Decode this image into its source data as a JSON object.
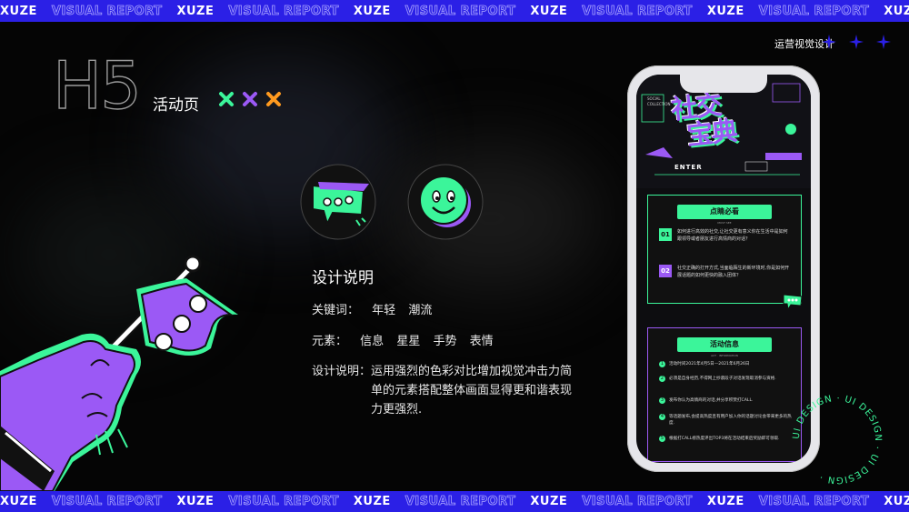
{
  "banner": {
    "segments": [
      {
        "text": "XUZE",
        "style": "solid"
      },
      {
        "text": "VISUAL REPORT",
        "style": "outline"
      },
      {
        "text": "XUZE",
        "style": "solid"
      },
      {
        "text": "VISUAL REPORT",
        "style": "outline"
      },
      {
        "text": "XUZE",
        "style": "solid"
      },
      {
        "text": "VISUAL REPORT",
        "style": "outline"
      },
      {
        "text": "XUZE",
        "style": "solid"
      },
      {
        "text": "VISUAL REPORT",
        "style": "outline"
      },
      {
        "text": "XUZE",
        "style": "solid"
      },
      {
        "text": "VISUAL REPORT",
        "style": "outline"
      },
      {
        "text": "XUZE",
        "style": "solid"
      },
      {
        "text": "VISUAL REPORT",
        "style": "outline"
      }
    ],
    "color": "#2b20e6"
  },
  "header": {
    "big_title": "H5",
    "subtitle": "活动页",
    "x_marks": [
      {
        "icon": "x-icon",
        "color": "#3bf59a"
      },
      {
        "icon": "x-icon",
        "color": "#9b59f5"
      },
      {
        "icon": "x-icon",
        "color": "#ff9a1f"
      }
    ],
    "top_right_label": "运营视觉设计",
    "stars": [
      {
        "icon": "sparkle-star-icon",
        "color": "#2b20e6"
      },
      {
        "icon": "sparkle-star-icon",
        "color": "#2b20e6"
      },
      {
        "icon": "sparkle-star-icon",
        "color": "#2b20e6"
      }
    ]
  },
  "icons": [
    {
      "name": "chat-bubble-icon",
      "bg": "#3bf59a"
    },
    {
      "name": "smiley-face-icon",
      "bg": "#3bf59a"
    }
  ],
  "description": {
    "title": "设计说明",
    "keywords_label": "关键词：",
    "keywords": [
      "年轻",
      "潮流"
    ],
    "elements_label": "元素：",
    "elements": [
      "信息",
      "星星",
      "手势",
      "表情"
    ],
    "explain_label": "设计说明：",
    "explain_text": "运用强烈的色彩对比增加视觉冲击力简单的元素搭配整体画面显得更和谐表现力更强烈."
  },
  "phone": {
    "hero_title_line1": "社交",
    "hero_title_line2": "宝典",
    "hero_small": "SOCIAL COLLECTION",
    "enter_label": "ENTER",
    "card1": {
      "heading": "点睛必看",
      "heading_sub": "MUST SEE",
      "questions": [
        {
          "num": "01",
          "text": "如何进行高效的社交,让社交更有意义你在生活中是如何跟领导或者朋友进行高情商的对话？"
        },
        {
          "num": "02",
          "text": "社交正确的打开方式,当面临陌生的新环境时,你是如何开展话题的如何更快的融入团体？"
        }
      ]
    },
    "card2": {
      "heading": "活动信息",
      "heading_sub": "ACT · INFORMATION",
      "items": [
        {
          "num": "1",
          "text": "活动时间2021年4月5日—2021年6月26日"
        },
        {
          "num": "2",
          "text": "必须是自身经历,不得网上抄袭段子对话发现取消参与资格."
        },
        {
          "num": "3",
          "text": "发布你认为高情商的对话,并分享积赞打CALL."
        },
        {
          "num": "4",
          "text": "等话题发布,会提高热度且有用户加入你的话题讨论会带来更多的热度."
        },
        {
          "num": "5",
          "text": "根据打CALL榜热度评出TOP3将在活动结束后奖励即可领取."
        }
      ]
    }
  },
  "ring_text": "UI DESIGN · UI DESIGN · UI DESIGN ·",
  "colors": {
    "green": "#3bf59a",
    "purple": "#9b59f5",
    "orange": "#ff9a1f",
    "blue": "#2b20e6"
  }
}
